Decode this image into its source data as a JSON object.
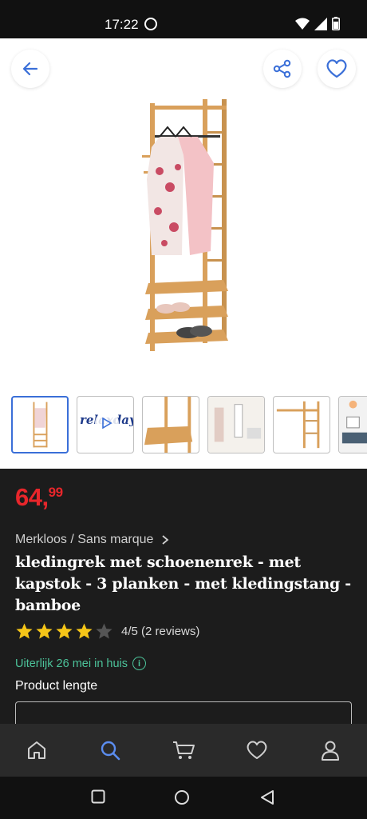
{
  "status_bar": {
    "time": "17:22"
  },
  "header": {
    "back_icon": "arrow-left-icon",
    "share_icon": "share-icon",
    "favorite_icon": "heart-icon"
  },
  "gallery": {
    "thumbnails": [
      "thumbnail-1",
      "thumbnail-2-video",
      "thumbnail-3",
      "thumbnail-4",
      "thumbnail-5",
      "thumbnail-6"
    ],
    "video_brand_text": "relaxdays"
  },
  "product": {
    "price_main": "64,",
    "price_cents": "99",
    "brand": "Merkloos / Sans marque",
    "title": "kledingrek met schoenenrek - met kapstok - 3 planken - met kledingstang - bamboe",
    "rating_value": 4,
    "rating_max": 5,
    "rating_text": "4/5 (2 reviews)",
    "delivery": "Uiterlijk 26 mei in huis",
    "size_label": "Product lengte"
  },
  "colors": {
    "price": "#e8262b",
    "accent": "#3a6fd8",
    "delivery": "#4cc39a",
    "star": "#f5c518"
  },
  "bottom_nav": [
    "home-icon",
    "search-icon",
    "cart-icon",
    "heart-icon",
    "account-icon"
  ]
}
